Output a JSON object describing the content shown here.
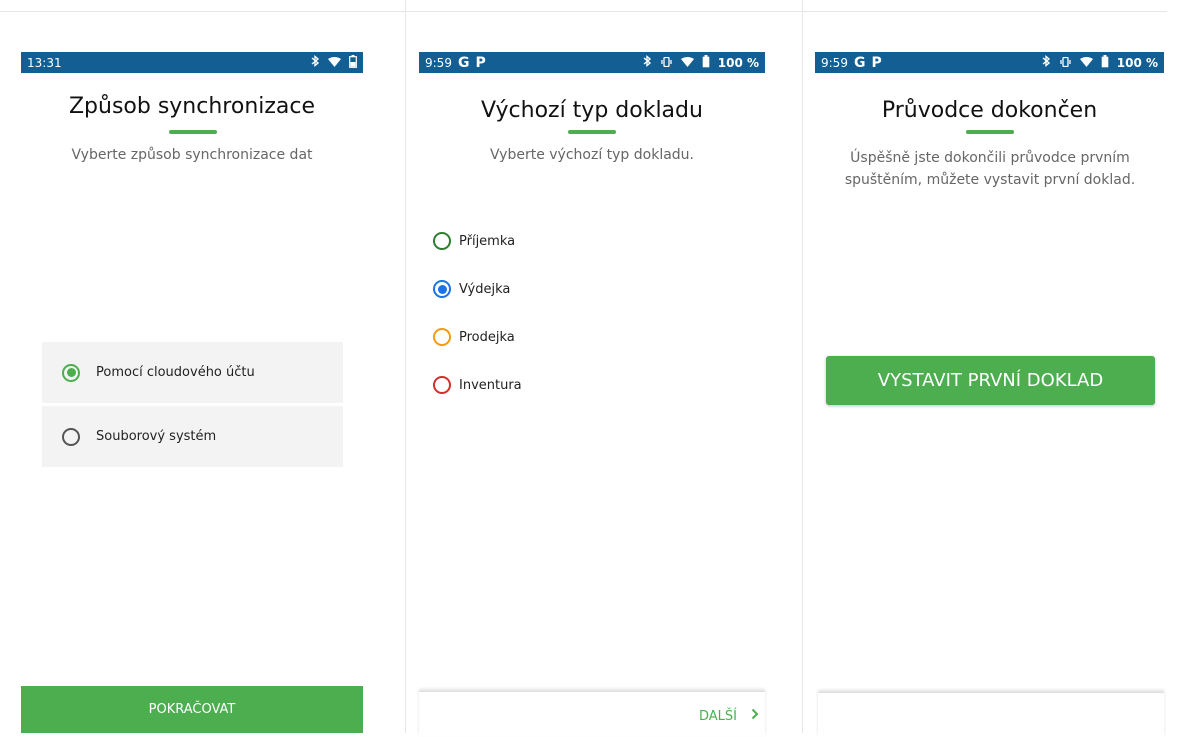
{
  "colors": {
    "accent": "#4cae4f",
    "statusbar": "#135f94",
    "blue": "#1a73e8",
    "orange": "#f39c12",
    "red": "#d32f2f",
    "green": "#2e7d32"
  },
  "screen1": {
    "status": {
      "time": "13:31",
      "icons": [
        "bluetooth-icon",
        "wifi-icon",
        "battery-icon"
      ]
    },
    "title": "Způsob synchronizace",
    "subtitle": "Vyberte způsob synchronizace dat",
    "options": [
      {
        "label": "Pomocí cloudového účtu",
        "selected": true
      },
      {
        "label": "Souborový systém",
        "selected": false
      }
    ],
    "button": "POKRAČOVAT"
  },
  "screen2": {
    "status": {
      "time": "9:59",
      "left_icons": [
        "g-icon",
        "p-icon"
      ],
      "battery": "100 %"
    },
    "title": "Výchozí typ dokladu",
    "subtitle": "Vyberte výchozí typ dokladu.",
    "options": [
      {
        "label": "Příjemka",
        "color": "green",
        "selected": false
      },
      {
        "label": "Výdejka",
        "color": "blue",
        "selected": true
      },
      {
        "label": "Prodejka",
        "color": "orange",
        "selected": false
      },
      {
        "label": "Inventura",
        "color": "red",
        "selected": false
      }
    ],
    "next": "DALŠÍ"
  },
  "screen3": {
    "status": {
      "time": "9:59",
      "left_icons": [
        "g-icon",
        "p-icon"
      ],
      "battery": "100 %"
    },
    "title": "Průvodce dokončen",
    "subtitle": "Úspěšně jste dokončili průvodce prvním spuštěním, můžete vystavit první doklad.",
    "button": "VYSTAVIT PRVNÍ DOKLAD"
  }
}
